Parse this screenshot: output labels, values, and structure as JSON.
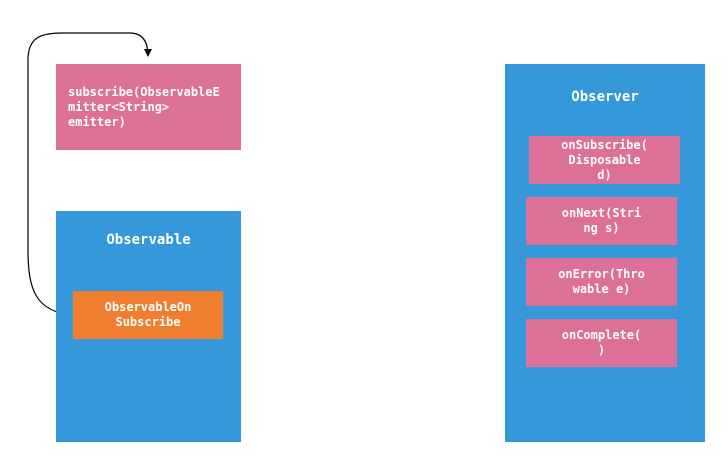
{
  "colors": {
    "blue": "#3498db",
    "pink": "#dc7096",
    "orange": "#ef7f2f",
    "connector": "#000000"
  },
  "subscribe_box": {
    "label": "subscribe(ObservableE\nmitter<String>\nemitter)"
  },
  "observable": {
    "title": "Observable",
    "on_subscribe": "ObservableOn\nSubscribe"
  },
  "observer": {
    "title": "Observer",
    "methods": [
      "onSubscribe(\nDisposable\nd)",
      "onNext(Stri\nng s)",
      "onError(Thro\nwable e)",
      "onComplete(\n)"
    ]
  }
}
